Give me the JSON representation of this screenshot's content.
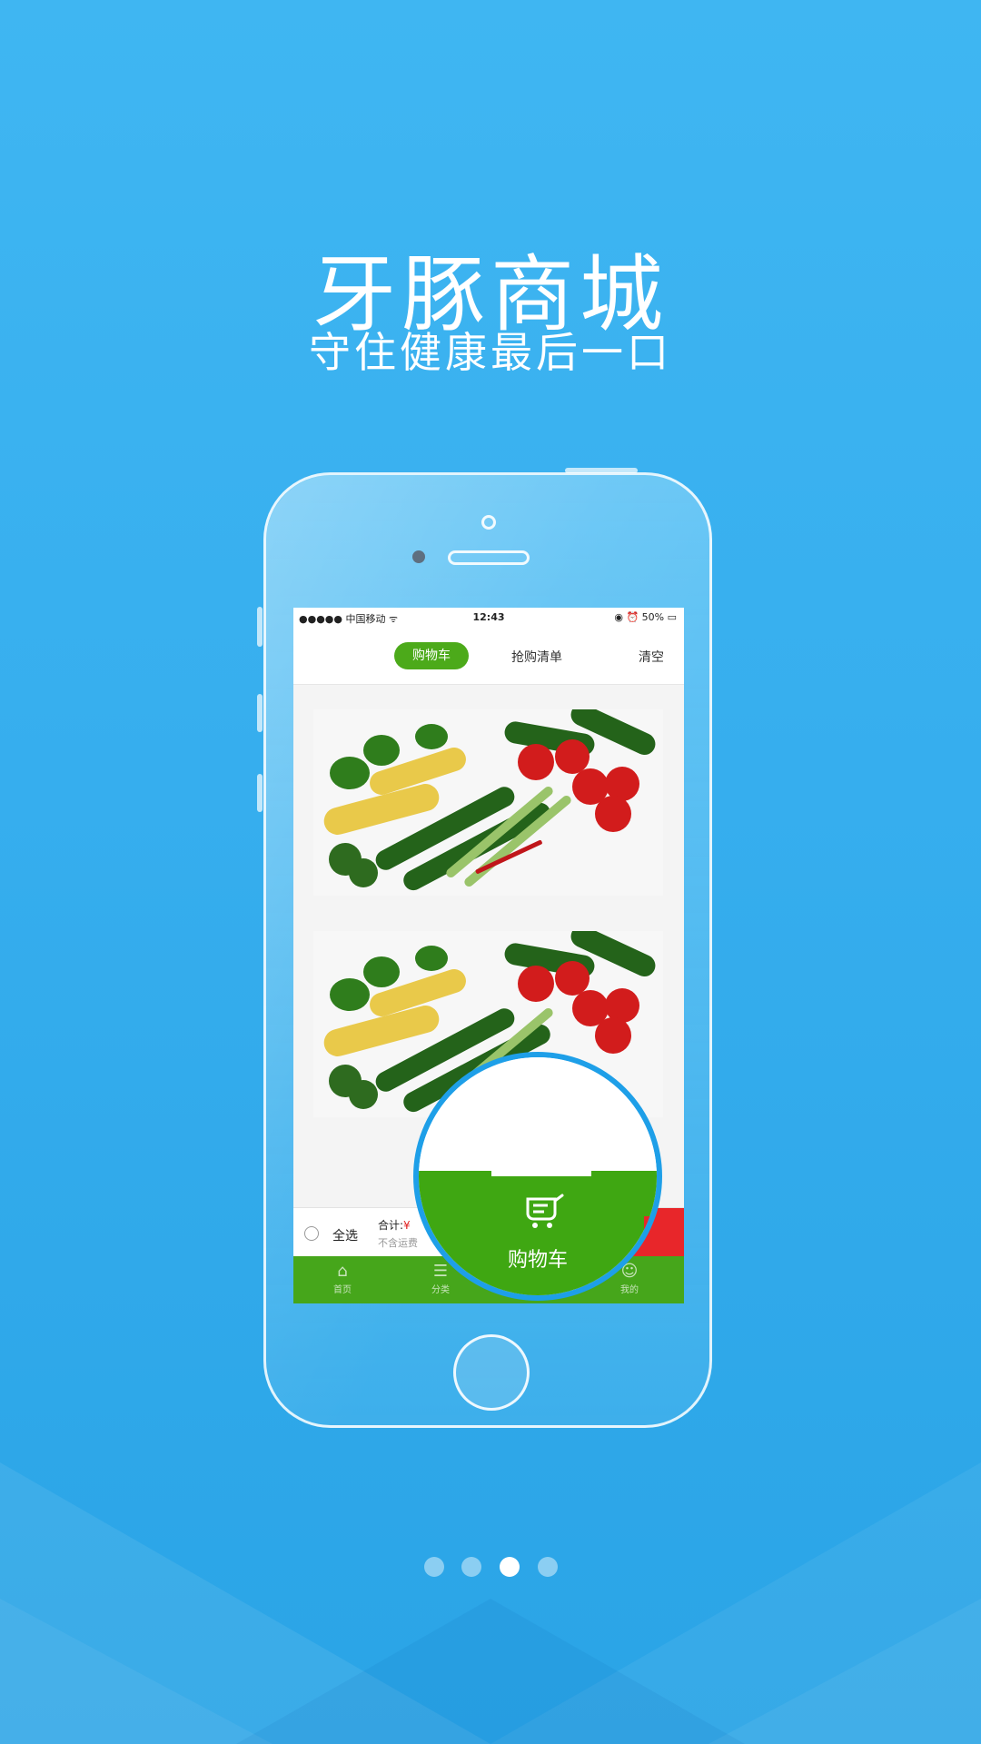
{
  "brand": {
    "title": "牙豚商城",
    "subtitle": "守住健康最后一口"
  },
  "status_bar": {
    "carrier": "●●●●● 中国移动 ᯤ",
    "time": "12:43",
    "battery": "◉ ⏰ 50% ▭"
  },
  "top_tabs": {
    "cart": "购物车",
    "flash_list": "抢购清单",
    "clear": "清空"
  },
  "cart_bar": {
    "select_all": "全选",
    "total_label": "合计:",
    "currency": "¥",
    "shipping_note": "不含运费"
  },
  "tab_bar": [
    {
      "label": "首页",
      "icon": "home-icon"
    },
    {
      "label": "分类",
      "icon": "list-icon"
    },
    {
      "label": "我的",
      "icon": "user-icon"
    }
  ],
  "magnifier": {
    "label": "购物车",
    "icon": "cart-icon"
  },
  "pager": {
    "total": 4,
    "active": 3
  },
  "colors": {
    "accent_green": "#46a61b",
    "checkout_red": "#e8262a",
    "background_blue": "#36aeee"
  }
}
